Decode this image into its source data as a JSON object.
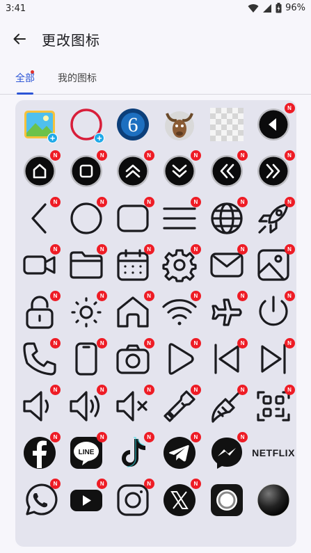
{
  "status_bar": {
    "time": "3:41",
    "battery": "96%"
  },
  "app_bar": {
    "title": "更改图标"
  },
  "tabs": [
    {
      "label": "全部",
      "active": true
    },
    {
      "label": "我的图标",
      "active": false
    }
  ],
  "badge_text": "N",
  "add_badge_text": "+",
  "netflix_label": "NETFLIX",
  "colors": {
    "accent": "#2c55d6",
    "badge": "#ee1c25",
    "add_badge": "#1fa9e8",
    "panel_bg": "#e4e4ee"
  },
  "icons": [
    {
      "name": "gallery-app-icon",
      "badge": "add"
    },
    {
      "name": "red-ring-icon",
      "badge": "add"
    },
    {
      "name": "blue-six-icon",
      "badge": "none"
    },
    {
      "name": "moose-icon",
      "badge": "none"
    },
    {
      "name": "transparent-icon",
      "badge": "none"
    },
    {
      "name": "black-circle-back-icon",
      "badge": "new"
    },
    {
      "name": "black-circle-home-icon",
      "badge": "new"
    },
    {
      "name": "black-circle-square-icon",
      "badge": "new"
    },
    {
      "name": "black-circle-chevron-up-icon",
      "badge": "new"
    },
    {
      "name": "black-circle-chevron-down-icon",
      "badge": "new"
    },
    {
      "name": "black-circle-rewind-icon",
      "badge": "new"
    },
    {
      "name": "black-circle-forward-icon",
      "badge": "new"
    },
    {
      "name": "chevron-left-icon",
      "badge": "new"
    },
    {
      "name": "circle-outline-icon",
      "badge": "new"
    },
    {
      "name": "rounded-square-icon",
      "badge": "new"
    },
    {
      "name": "menu-lines-icon",
      "badge": "new"
    },
    {
      "name": "globe-icon",
      "badge": "new"
    },
    {
      "name": "rocket-icon",
      "badge": "new"
    },
    {
      "name": "video-camera-icon",
      "badge": "new"
    },
    {
      "name": "folder-icon",
      "badge": "new"
    },
    {
      "name": "calendar-icon",
      "badge": "new"
    },
    {
      "name": "gear-icon",
      "badge": "new"
    },
    {
      "name": "mail-icon",
      "badge": "new"
    },
    {
      "name": "image-icon",
      "badge": "new"
    },
    {
      "name": "lock-icon",
      "badge": "new"
    },
    {
      "name": "brightness-icon",
      "badge": "new"
    },
    {
      "name": "home-icon",
      "badge": "new"
    },
    {
      "name": "wifi-icon",
      "badge": "new"
    },
    {
      "name": "airplane-icon",
      "badge": "new"
    },
    {
      "name": "power-icon",
      "badge": "new"
    },
    {
      "name": "phone-icon",
      "badge": "new"
    },
    {
      "name": "smartphone-icon",
      "badge": "new"
    },
    {
      "name": "camera-icon",
      "badge": "new"
    },
    {
      "name": "play-icon",
      "badge": "new"
    },
    {
      "name": "skip-previous-icon",
      "badge": "new"
    },
    {
      "name": "skip-next-icon",
      "badge": "new"
    },
    {
      "name": "volume-low-icon",
      "badge": "new"
    },
    {
      "name": "volume-high-icon",
      "badge": "new"
    },
    {
      "name": "volume-mute-icon",
      "badge": "new"
    },
    {
      "name": "flashlight-icon",
      "badge": "new"
    },
    {
      "name": "broom-icon",
      "badge": "new"
    },
    {
      "name": "qr-scan-icon",
      "badge": "new"
    },
    {
      "name": "facebook-icon",
      "badge": "new"
    },
    {
      "name": "line-icon",
      "badge": "new"
    },
    {
      "name": "tiktok-icon",
      "badge": "new"
    },
    {
      "name": "telegram-icon",
      "badge": "new"
    },
    {
      "name": "messenger-icon",
      "badge": "new"
    },
    {
      "name": "netflix-icon",
      "badge": "none"
    },
    {
      "name": "whatsapp-icon",
      "badge": "new"
    },
    {
      "name": "youtube-icon",
      "badge": "new"
    },
    {
      "name": "instagram-icon",
      "badge": "new"
    },
    {
      "name": "x-icon",
      "badge": "new"
    },
    {
      "name": "silver-ring-icon",
      "badge": "none"
    },
    {
      "name": "dark-sphere-icon",
      "badge": "none"
    },
    {
      "name": "brick-icon",
      "badge": "none"
    },
    {
      "name": "color-swatch-icon",
      "badge": "none"
    },
    {
      "name": "blue-yellow-tiles-icon",
      "badge": "none"
    },
    {
      "name": "mint-tiles-icon",
      "badge": "none"
    },
    {
      "name": "palm-plant-icon",
      "badge": "none"
    },
    {
      "name": "monstera-plant-icon",
      "badge": "none"
    }
  ]
}
